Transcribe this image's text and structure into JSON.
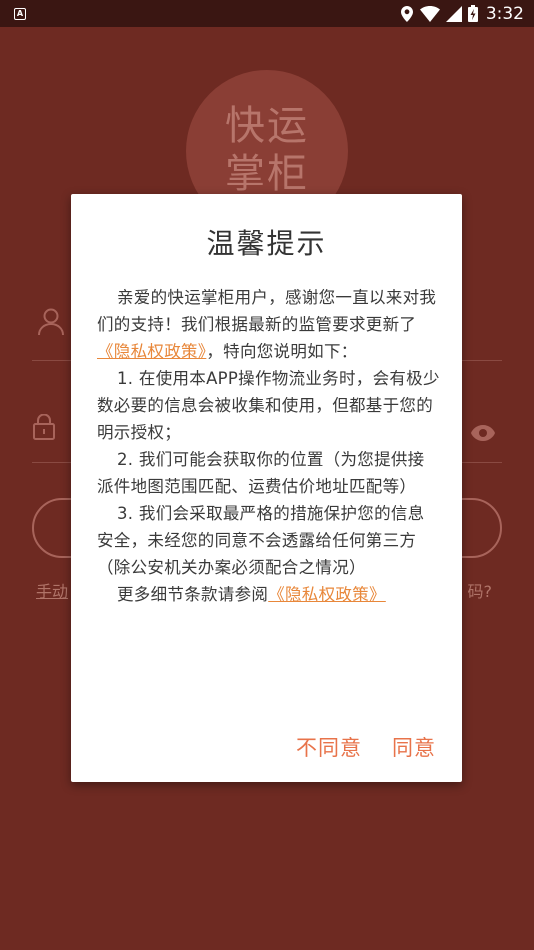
{
  "status_bar": {
    "notification_icon_letter": "A",
    "time": "3:32"
  },
  "background": {
    "logo_line1": "快运",
    "logo_line2": "掌柜",
    "manual_link": "手动",
    "forgot_link": "码?"
  },
  "dialog": {
    "title": "温馨提示",
    "intro_text": "亲爱的快运掌柜用户，感谢您一直以来对我们的支持！我们根据最新的监管要求更新了",
    "intro_link": "《隐私权政策》",
    "intro_suffix": "，特向您说明如下：",
    "item1": "1. 在使用本APP操作物流业务时，会有极少数必要的信息会被收集和使用，但都基于您的明示授权；",
    "item2": "2. 我们可能会获取你的位置（为您提供接派件地图范围匹配、运费估价地址匹配等）",
    "item3": "3. 我们会采取最严格的措施保护您的信息安全，未经您的同意不会透露给任何第三方（除公安机关办案必须配合之情况）",
    "more_text": "更多细节条款请参阅",
    "more_link": "《隐私权政策》",
    "disagree_label": "不同意",
    "agree_label": "同意"
  },
  "colors": {
    "overlay_background": "#6e2a22",
    "accent": "#e8734a",
    "link": "#e8873a"
  }
}
